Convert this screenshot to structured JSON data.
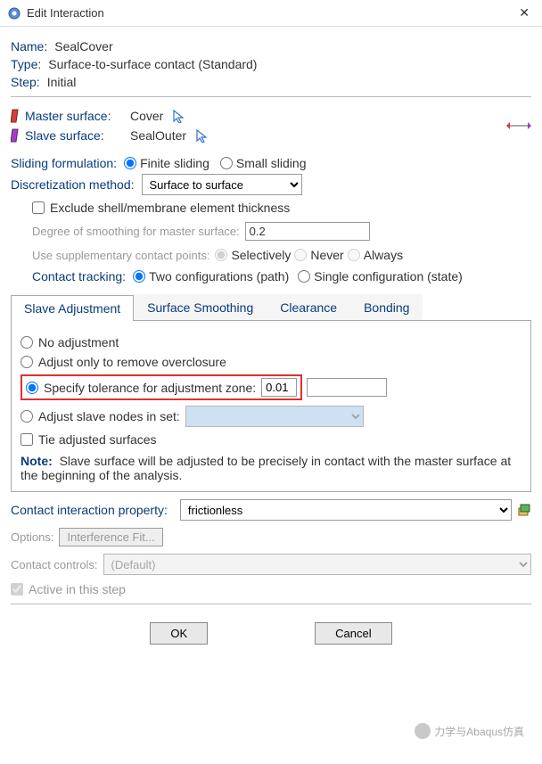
{
  "titlebar": {
    "title": "Edit Interaction"
  },
  "fields": {
    "name_label": "Name:",
    "name_value": "SealCover",
    "type_label": "Type:",
    "type_value": "Surface-to-surface contact (Standard)",
    "step_label": "Step:",
    "step_value": "Initial"
  },
  "surfaces": {
    "master_label": "Master surface:",
    "master_value": "Cover",
    "slave_label": "Slave surface:",
    "slave_value": "SealOuter"
  },
  "sliding": {
    "label": "Sliding formulation:",
    "opt_finite": "Finite sliding",
    "opt_small": "Small sliding"
  },
  "discretization": {
    "label": "Discretization method:",
    "value": "Surface to surface"
  },
  "exclude_label": "Exclude shell/membrane element thickness",
  "smoothing": {
    "label": "Degree of smoothing for master surface:",
    "value": "0.2"
  },
  "supplementary": {
    "label": "Use supplementary contact points:",
    "opt_sel": "Selectively",
    "opt_never": "Never",
    "opt_always": "Always"
  },
  "tracking": {
    "label": "Contact tracking:",
    "opt_two": "Two configurations (path)",
    "opt_single": "Single configuration (state)"
  },
  "tabs": {
    "slave_adj": "Slave Adjustment",
    "surf_smooth": "Surface Smoothing",
    "clearance": "Clearance",
    "bonding": "Bonding"
  },
  "adj": {
    "no_adj": "No adjustment",
    "remove_over": "Adjust only to remove overclosure",
    "specify_tol": "Specify tolerance for adjustment zone:",
    "tol_value": "0.01",
    "adjust_nodes": "Adjust slave nodes in set:",
    "tie": "Tie adjusted surfaces",
    "note_label": "Note:",
    "note_text": "Slave surface will be adjusted to be precisely in contact with the master surface at the beginning of the analysis."
  },
  "contact_prop": {
    "label": "Contact interaction property:",
    "value": "frictionless"
  },
  "options": {
    "label": "Options:",
    "btn": "Interference Fit..."
  },
  "controls": {
    "label": "Contact controls:",
    "value": "(Default)"
  },
  "active_label": "Active in this step",
  "buttons": {
    "ok": "OK",
    "cancel": "Cancel"
  },
  "watermark": "力学与Abaqus仿真"
}
